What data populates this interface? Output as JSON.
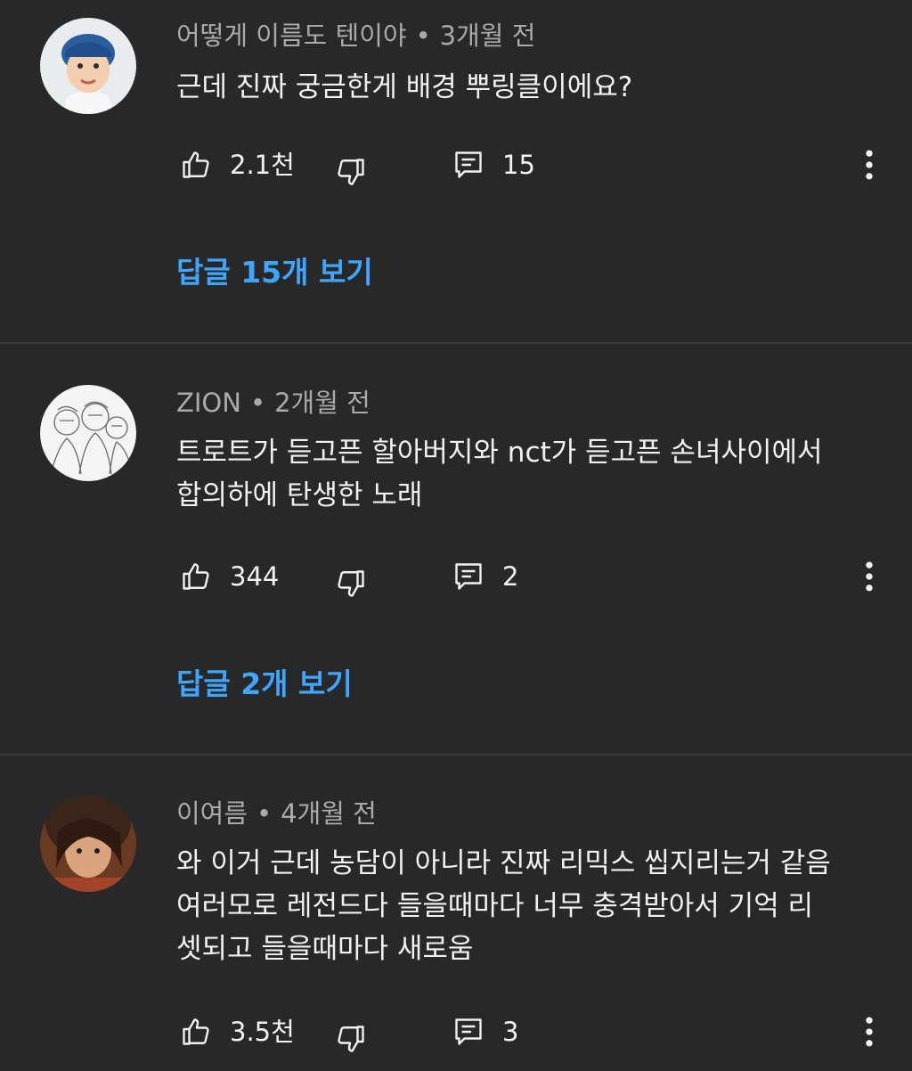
{
  "comments": [
    {
      "author": "어떻게 이름도 텐이야",
      "time": "3개월 전",
      "lines": [
        "근데 진짜 궁금한게 배경 뿌링클이에요?"
      ],
      "likes": "2.1천",
      "reply_count": "15",
      "view_replies": "답글 15개 보기"
    },
    {
      "author": "ZION",
      "time": "2개월 전",
      "lines": [
        "트로트가 듣고픈 할아버지와 nct가 듣고픈 손녀사이에서",
        "합의하에 탄생한 노래"
      ],
      "likes": "344",
      "reply_count": "2",
      "view_replies": "답글 2개 보기"
    },
    {
      "author": "이여름",
      "time": "4개월 전",
      "lines": [
        "와 이거 근데 농담이 아니라 진짜 리믹스 씹지리는거 같음",
        "여러모로 레전드다 들을때마다 너무 충격받아서 기억 리",
        "셋되고 들을때마다 새로움"
      ],
      "likes": "3.5천",
      "reply_count": "3"
    }
  ],
  "separator": "•",
  "icons": {
    "like": "thumbs-up-icon",
    "dislike": "thumbs-down-icon",
    "reply": "comment-icon",
    "menu": "more-vertical-icon"
  },
  "colors": {
    "background": "#282828",
    "link": "#3ea6ff",
    "meta": "#aaaaaa",
    "text": "#f1f1f1"
  }
}
